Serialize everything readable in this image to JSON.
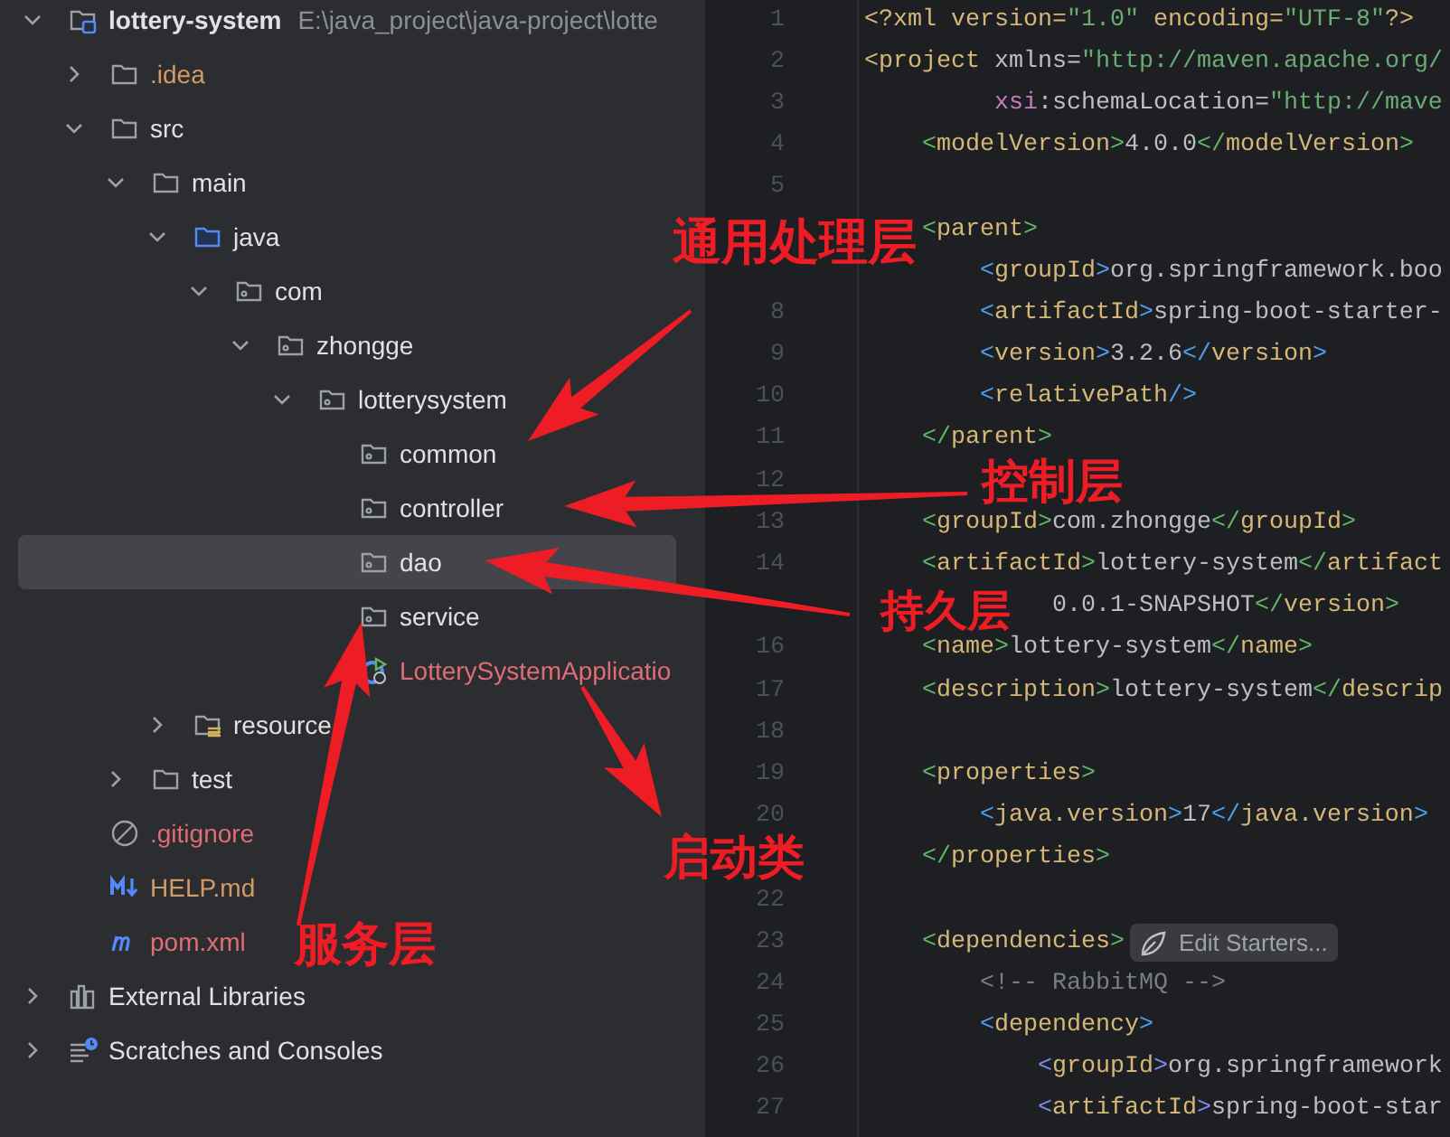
{
  "project_tree": [
    {
      "label": "lottery-system",
      "path": "E:\\java_project\\java-project\\lotte",
      "kind": "module",
      "expanded": true,
      "selected": false,
      "children": [
        {
          "label": ".idea",
          "kind": "folder",
          "color": "#d19a66",
          "expanded": false,
          "selected": false
        },
        {
          "label": "src",
          "kind": "folder",
          "expanded": true,
          "selected": false,
          "children": [
            {
              "label": "main",
              "kind": "folder",
              "expanded": true,
              "selected": false,
              "children": [
                {
                  "label": "java",
                  "kind": "source-folder",
                  "expanded": true,
                  "selected": false,
                  "children": [
                    {
                      "label": "com",
                      "kind": "package",
                      "expanded": true,
                      "selected": false,
                      "children": [
                        {
                          "label": "zhongge",
                          "kind": "package",
                          "expanded": true,
                          "selected": false,
                          "children": [
                            {
                              "label": "lotterysystem",
                              "kind": "package",
                              "expanded": true,
                              "selected": false,
                              "children": [
                                {
                                  "label": "common",
                                  "kind": "package",
                                  "selected": false
                                },
                                {
                                  "label": "controller",
                                  "kind": "package",
                                  "selected": false
                                },
                                {
                                  "label": "dao",
                                  "kind": "package",
                                  "selected": true
                                },
                                {
                                  "label": "service",
                                  "kind": "package",
                                  "selected": false
                                },
                                {
                                  "label": "LotterySystemApplicatio",
                                  "kind": "spring-app",
                                  "color": "#e06c75",
                                  "selected": false
                                }
                              ]
                            }
                          ]
                        }
                      ]
                    }
                  ]
                },
                {
                  "label": "resource",
                  "kind": "resources-folder",
                  "expanded": false,
                  "selected": false
                }
              ]
            },
            {
              "label": "test",
              "kind": "folder",
              "expanded": false,
              "selected": false
            }
          ]
        },
        {
          "label": ".gitignore",
          "kind": "gitignore",
          "color": "#e06c75",
          "selected": false
        },
        {
          "label": "HELP.md",
          "kind": "markdown",
          "color": "#d19a66",
          "selected": false
        },
        {
          "label": "pom.xml",
          "kind": "maven",
          "color": "#e06c75",
          "selected": false
        }
      ]
    },
    {
      "label": "External Libraries",
      "kind": "libraries",
      "expanded": false,
      "selected": false
    },
    {
      "label": "Scratches and Consoles",
      "kind": "scratches",
      "expanded": false,
      "selected": false
    }
  ],
  "editor": {
    "lines": [
      {
        "number": "1",
        "segments": [
          {
            "text": "<?xml version=",
            "kind": "tag"
          },
          {
            "text": "\"1.0\"",
            "kind": "value"
          },
          {
            "text": " encoding=",
            "kind": "tag"
          },
          {
            "text": "\"UTF-8\"",
            "kind": "value"
          },
          {
            "text": "?>",
            "kind": "tag"
          }
        ]
      },
      {
        "number": "2",
        "segments": [
          {
            "text": "<project",
            "kind": "tag"
          },
          {
            "text": " xmlns=",
            "kind": "plain"
          },
          {
            "text": "\"http://maven.apache.org/",
            "kind": "value"
          }
        ]
      },
      {
        "number": "3",
        "segments": [
          {
            "text": "xsi",
            "kind": "ns"
          },
          {
            "text": ":schemaLocation=",
            "kind": "plain"
          },
          {
            "text": "\"http://mave",
            "kind": "value"
          }
        ]
      },
      {
        "number": "4",
        "segments": [
          {
            "text": "<",
            "kind": "bracket1"
          },
          {
            "text": "modelVersion",
            "kind": "tag"
          },
          {
            "text": ">",
            "kind": "bracket1"
          },
          {
            "text": "4.0.0",
            "kind": "plain"
          },
          {
            "text": "</",
            "kind": "bracket1"
          },
          {
            "text": "modelVersion",
            "kind": "tag"
          },
          {
            "text": ">",
            "kind": "bracket1"
          }
        ]
      },
      {
        "number": "5"
      },
      {
        "segments": [
          {
            "text": "<",
            "kind": "bracket1"
          },
          {
            "text": "parent",
            "kind": "tag"
          },
          {
            "text": ">",
            "kind": "bracket1"
          }
        ]
      },
      {
        "segments": [
          {
            "text": "<",
            "kind": "bracket2"
          },
          {
            "text": "groupId",
            "kind": "tag"
          },
          {
            "text": ">",
            "kind": "bracket2"
          },
          {
            "text": "org.springframework.boo",
            "kind": "plain"
          }
        ]
      },
      {
        "number": "8",
        "segments": [
          {
            "text": "<",
            "kind": "bracket2"
          },
          {
            "text": "artifactId",
            "kind": "tag"
          },
          {
            "text": ">",
            "kind": "bracket2"
          },
          {
            "text": "spring-boot-starter-",
            "kind": "plain"
          }
        ]
      },
      {
        "number": "9",
        "segments": [
          {
            "text": "<",
            "kind": "bracket2"
          },
          {
            "text": "version",
            "kind": "tag"
          },
          {
            "text": ">",
            "kind": "bracket2"
          },
          {
            "text": "3.2.6",
            "kind": "plain"
          },
          {
            "text": "</",
            "kind": "bracket2"
          },
          {
            "text": "version",
            "kind": "tag"
          },
          {
            "text": ">",
            "kind": "bracket2"
          }
        ]
      },
      {
        "number": "10",
        "segments": [
          {
            "text": "<",
            "kind": "bracket2"
          },
          {
            "text": "relativePath",
            "kind": "tag"
          },
          {
            "text": "/>",
            "kind": "bracket2"
          }
        ]
      },
      {
        "number": "11",
        "segments": [
          {
            "text": "</",
            "kind": "bracket1"
          },
          {
            "text": "parent",
            "kind": "tag"
          },
          {
            "text": ">",
            "kind": "bracket1"
          }
        ]
      },
      {
        "number": "12"
      },
      {
        "number": "13",
        "segments": [
          {
            "text": "<",
            "kind": "bracket1"
          },
          {
            "text": "groupId",
            "kind": "tag"
          },
          {
            "text": ">",
            "kind": "bracket1"
          },
          {
            "text": "com.zhongge",
            "kind": "plain"
          },
          {
            "text": "</",
            "kind": "bracket1"
          },
          {
            "text": "groupId",
            "kind": "tag"
          },
          {
            "text": ">",
            "kind": "bracket1"
          }
        ]
      },
      {
        "number": "14",
        "segments": [
          {
            "text": "<",
            "kind": "bracket1"
          },
          {
            "text": "artifactId",
            "kind": "tag"
          },
          {
            "text": ">",
            "kind": "bracket1"
          },
          {
            "text": "lottery-system",
            "kind": "plain"
          },
          {
            "text": "</",
            "kind": "bracket1"
          },
          {
            "text": "artifact",
            "kind": "tag"
          }
        ]
      },
      {
        "segments": [
          {
            "text": "0.0.1-SNAPSHOT",
            "kind": "plain"
          },
          {
            "text": "</",
            "kind": "bracket1"
          },
          {
            "text": "version",
            "kind": "tag"
          },
          {
            "text": ">",
            "kind": "bracket1"
          }
        ]
      },
      {
        "number": "16",
        "segments": [
          {
            "text": "<",
            "kind": "bracket1"
          },
          {
            "text": "name",
            "kind": "tag"
          },
          {
            "text": ">",
            "kind": "bracket1"
          },
          {
            "text": "lottery-system",
            "kind": "plain"
          },
          {
            "text": "</",
            "kind": "bracket1"
          },
          {
            "text": "name",
            "kind": "tag"
          },
          {
            "text": ">",
            "kind": "bracket1"
          }
        ]
      },
      {
        "number": "17",
        "segments": [
          {
            "text": "<",
            "kind": "bracket1"
          },
          {
            "text": "description",
            "kind": "tag"
          },
          {
            "text": ">",
            "kind": "bracket1"
          },
          {
            "text": "lottery-system",
            "kind": "plain"
          },
          {
            "text": "</",
            "kind": "bracket1"
          },
          {
            "text": "descrip",
            "kind": "tag"
          }
        ]
      },
      {
        "number": "18"
      },
      {
        "number": "19",
        "segments": [
          {
            "text": "<",
            "kind": "bracket1"
          },
          {
            "text": "properties",
            "kind": "tag"
          },
          {
            "text": ">",
            "kind": "bracket1"
          }
        ]
      },
      {
        "number": "20",
        "segments": [
          {
            "text": "<",
            "kind": "bracket2"
          },
          {
            "text": "java.version",
            "kind": "tag"
          },
          {
            "text": ">",
            "kind": "bracket2"
          },
          {
            "text": "17",
            "kind": "plain"
          },
          {
            "text": "</",
            "kind": "bracket2"
          },
          {
            "text": "java.version",
            "kind": "tag"
          },
          {
            "text": ">",
            "kind": "bracket2"
          }
        ]
      },
      {
        "segments": [
          {
            "text": "</",
            "kind": "bracket1"
          },
          {
            "text": "properties",
            "kind": "tag"
          },
          {
            "text": ">",
            "kind": "bracket1"
          }
        ]
      },
      {
        "number": "22"
      },
      {
        "number": "23",
        "segments": [
          {
            "text": "<",
            "kind": "bracket1"
          },
          {
            "text": "dependencies",
            "kind": "tag"
          },
          {
            "text": ">",
            "kind": "bracket1"
          }
        ],
        "inlay": "Edit Starters..."
      },
      {
        "number": "24",
        "segments": [
          {
            "text": "<!-- RabbitMQ -->",
            "kind": "comment"
          }
        ]
      },
      {
        "number": "25",
        "segments": [
          {
            "text": "<",
            "kind": "bracket2"
          },
          {
            "text": "dependency",
            "kind": "tag"
          },
          {
            "text": ">",
            "kind": "bracket2"
          }
        ]
      },
      {
        "number": "26",
        "segments": [
          {
            "text": "<",
            "kind": "bracket3"
          },
          {
            "text": "groupId",
            "kind": "tag"
          },
          {
            "text": ">",
            "kind": "bracket3"
          },
          {
            "text": "org.springframework",
            "kind": "plain"
          }
        ]
      },
      {
        "number": "27",
        "segments": [
          {
            "text": "<",
            "kind": "bracket3"
          },
          {
            "text": "artifactId",
            "kind": "tag"
          },
          {
            "text": ">",
            "kind": "bracket3"
          },
          {
            "text": "spring-boot-star",
            "kind": "plain"
          }
        ]
      }
    ]
  },
  "annotations": [
    {
      "label": "通用处理层"
    },
    {
      "label": "控制层"
    },
    {
      "label": "持久层"
    },
    {
      "label": "启动类"
    },
    {
      "label": "服务层"
    }
  ]
}
